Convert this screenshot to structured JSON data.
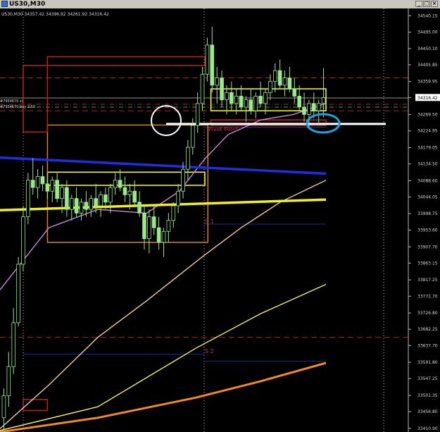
{
  "window": {
    "title": "US30,M30",
    "minimize_glyph": "_",
    "restore_glyph": "□",
    "close_glyph": "×"
  },
  "info_line": "US30,M30  34357.42 34396.92 34261.92 34316.42",
  "order_labels": [
    "#7954670 sl",
    "#7954670 buy 2.50"
  ],
  "chart_data": {
    "type": "candlestick",
    "symbol": "US30",
    "timeframe": "M30",
    "ohlc_last": {
      "open": 34357.42,
      "high": 34396.92,
      "low": 34261.92,
      "close": 34316.42
    },
    "y_ticks": [
      "34540.15",
      "34495.00",
      "34450.10",
      "34405.85",
      "34359.95",
      "34316.42",
      "34269.50",
      "34224.95",
      "34179.05",
      "34134.50",
      "34088.60",
      "34044.05",
      "33998.75",
      "33953.60",
      "33907.70",
      "33863.15",
      "33817.25",
      "33772.70",
      "33726.80",
      "33682.25",
      "33637.70",
      "33591.80",
      "33547.25",
      "33501.35",
      "33456.80",
      "33410.90"
    ],
    "y_range": [
      33401,
      34560
    ],
    "current_price": 34316.42,
    "pivot_labels": {
      "pivot": "Pivot Point",
      "s1": "S 1",
      "s2": "S 2"
    },
    "levels": {
      "pivot_point": 34235,
      "s1": 33970,
      "s2": 33595,
      "red_dashed": [
        34370,
        34280,
        33660
      ],
      "order_sl": 34315,
      "order_buy": 34290,
      "white_support": 34244
    },
    "moving_averages": [
      {
        "color": "#cc88dd",
        "points": [
          [
            0,
            33790
          ],
          [
            15,
            33960
          ],
          [
            30,
            34010
          ],
          [
            45,
            34000
          ],
          [
            55,
            34060
          ],
          [
            63,
            34150
          ],
          [
            70,
            34215
          ],
          [
            80,
            34255
          ],
          [
            90,
            34270
          ],
          [
            100,
            34300
          ]
        ]
      },
      {
        "color": "#f0c8b4",
        "points": [
          [
            0,
            33410
          ],
          [
            15,
            33530
          ],
          [
            30,
            33660
          ],
          [
            45,
            33760
          ],
          [
            62,
            33880
          ],
          [
            74,
            33960
          ],
          [
            86,
            34030
          ],
          [
            100,
            34090
          ]
        ]
      },
      {
        "color": "#f5ee60",
        "points": [
          [
            0,
            33405
          ],
          [
            30,
            33470
          ],
          [
            60,
            33630
          ],
          [
            80,
            33725
          ],
          [
            100,
            33805
          ]
        ]
      },
      {
        "color": "#f08a24",
        "points": [
          [
            0,
            33401
          ],
          [
            30,
            33440
          ],
          [
            60,
            33495
          ],
          [
            80,
            33540
          ],
          [
            100,
            33590
          ]
        ]
      }
    ],
    "trend_lines": [
      {
        "color": "#1f2fe0",
        "from": [
          0,
          34152
        ],
        "to": [
          100,
          34108
        ]
      },
      {
        "color": "#f0f020",
        "from": [
          0,
          34008
        ],
        "to": [
          100,
          34037
        ]
      }
    ],
    "boxes": [
      {
        "color": "#ffff33",
        "x0": 8,
        "x1": 60,
        "y0": 34076,
        "y1": 34112
      },
      {
        "color": "#ffff33",
        "x0": 62,
        "x1": 100,
        "y0": 34340,
        "y1": 34280
      },
      {
        "color": "#d0852a",
        "x0": 8,
        "x1": 61,
        "y0": 34241,
        "y1": 33920
      },
      {
        "color": "#c02020",
        "x0": 8,
        "x1": 60,
        "y0": 34428,
        "y1": 34404
      },
      {
        "color": "#c02020",
        "x0": 0,
        "x1": 8,
        "y0": 34404,
        "y1": 34222
      },
      {
        "color": "#c02020",
        "x0": 0,
        "x1": 8,
        "y0": 33490,
        "y1": 33460
      },
      {
        "color": "#c02020",
        "x0": 62,
        "x1": 100,
        "y0": 34255,
        "y1": 34240
      }
    ],
    "markers": [
      {
        "type": "circle",
        "color": "#ffffff",
        "x": 50,
        "y": 34230
      },
      {
        "type": "ellipse",
        "color": "#1fa3e0",
        "x": 99,
        "y": 34238
      }
    ],
    "candles": [
      {
        "o": 33440,
        "h": 33520,
        "l": 33405,
        "c": 33500
      },
      {
        "o": 33500,
        "h": 33620,
        "l": 33470,
        "c": 33580
      },
      {
        "o": 33580,
        "h": 33740,
        "l": 33560,
        "c": 33700
      },
      {
        "o": 33700,
        "h": 33880,
        "l": 33690,
        "c": 33860
      },
      {
        "o": 33860,
        "h": 34020,
        "l": 33840,
        "c": 33990
      },
      {
        "o": 33990,
        "h": 34110,
        "l": 33970,
        "c": 34090
      },
      {
        "o": 34090,
        "h": 34150,
        "l": 34050,
        "c": 34070
      },
      {
        "o": 34070,
        "h": 34120,
        "l": 34040,
        "c": 34100
      },
      {
        "o": 34100,
        "h": 34130,
        "l": 34060,
        "c": 34080
      },
      {
        "o": 34080,
        "h": 34110,
        "l": 34040,
        "c": 34060
      },
      {
        "o": 34060,
        "h": 34100,
        "l": 34030,
        "c": 34090
      },
      {
        "o": 34090,
        "h": 34110,
        "l": 34030,
        "c": 34040
      },
      {
        "o": 34040,
        "h": 34080,
        "l": 34000,
        "c": 34070
      },
      {
        "o": 34070,
        "h": 34090,
        "l": 33990,
        "c": 34010
      },
      {
        "o": 34010,
        "h": 34050,
        "l": 33980,
        "c": 34040
      },
      {
        "o": 34040,
        "h": 34070,
        "l": 33990,
        "c": 34000
      },
      {
        "o": 34000,
        "h": 34040,
        "l": 33980,
        "c": 34030
      },
      {
        "o": 34030,
        "h": 34060,
        "l": 33990,
        "c": 34010
      },
      {
        "o": 34010,
        "h": 34050,
        "l": 33990,
        "c": 34040
      },
      {
        "o": 34040,
        "h": 34080,
        "l": 34000,
        "c": 34020
      },
      {
        "o": 34020,
        "h": 34060,
        "l": 33990,
        "c": 34050
      },
      {
        "o": 34050,
        "h": 34070,
        "l": 34010,
        "c": 34030
      },
      {
        "o": 34030,
        "h": 34080,
        "l": 34000,
        "c": 34070
      },
      {
        "o": 34070,
        "h": 34110,
        "l": 34050,
        "c": 34090
      },
      {
        "o": 34090,
        "h": 34120,
        "l": 34060,
        "c": 34070
      },
      {
        "o": 34070,
        "h": 34100,
        "l": 34030,
        "c": 34050
      },
      {
        "o": 34050,
        "h": 34080,
        "l": 34010,
        "c": 34060
      },
      {
        "o": 34060,
        "h": 34090,
        "l": 34020,
        "c": 34030
      },
      {
        "o": 34030,
        "h": 34060,
        "l": 33990,
        "c": 34000
      },
      {
        "o": 34000,
        "h": 34020,
        "l": 33900,
        "c": 33930
      },
      {
        "o": 33930,
        "h": 34010,
        "l": 33890,
        "c": 33990
      },
      {
        "o": 33990,
        "h": 34020,
        "l": 33940,
        "c": 33960
      },
      {
        "o": 33960,
        "h": 33990,
        "l": 33900,
        "c": 33920
      },
      {
        "o": 33920,
        "h": 33960,
        "l": 33880,
        "c": 33950
      },
      {
        "o": 33950,
        "h": 34000,
        "l": 33920,
        "c": 33980
      },
      {
        "o": 33980,
        "h": 34030,
        "l": 33960,
        "c": 34020
      },
      {
        "o": 34020,
        "h": 34080,
        "l": 34000,
        "c": 34060
      },
      {
        "o": 34060,
        "h": 34140,
        "l": 34040,
        "c": 34120
      },
      {
        "o": 34120,
        "h": 34200,
        "l": 34090,
        "c": 34180
      },
      {
        "o": 34180,
        "h": 34260,
        "l": 34160,
        "c": 34240
      },
      {
        "o": 34240,
        "h": 34330,
        "l": 34220,
        "c": 34300
      },
      {
        "o": 34300,
        "h": 34400,
        "l": 34280,
        "c": 34380
      },
      {
        "o": 34380,
        "h": 34480,
        "l": 34360,
        "c": 34460
      },
      {
        "o": 34460,
        "h": 34510,
        "l": 34330,
        "c": 34350
      },
      {
        "o": 34350,
        "h": 34400,
        "l": 34300,
        "c": 34370
      },
      {
        "o": 34370,
        "h": 34390,
        "l": 34290,
        "c": 34310
      },
      {
        "o": 34310,
        "h": 34350,
        "l": 34270,
        "c": 34330
      },
      {
        "o": 34330,
        "h": 34360,
        "l": 34280,
        "c": 34300
      },
      {
        "o": 34300,
        "h": 34340,
        "l": 34270,
        "c": 34320
      },
      {
        "o": 34320,
        "h": 34350,
        "l": 34280,
        "c": 34290
      },
      {
        "o": 34290,
        "h": 34320,
        "l": 34250,
        "c": 34310
      },
      {
        "o": 34310,
        "h": 34340,
        "l": 34270,
        "c": 34280
      },
      {
        "o": 34280,
        "h": 34330,
        "l": 34260,
        "c": 34320
      },
      {
        "o": 34320,
        "h": 34360,
        "l": 34290,
        "c": 34300
      },
      {
        "o": 34300,
        "h": 34340,
        "l": 34270,
        "c": 34330
      },
      {
        "o": 34330,
        "h": 34380,
        "l": 34310,
        "c": 34360
      },
      {
        "o": 34360,
        "h": 34410,
        "l": 34330,
        "c": 34390
      },
      {
        "o": 34390,
        "h": 34420,
        "l": 34340,
        "c": 34350
      },
      {
        "o": 34350,
        "h": 34390,
        "l": 34320,
        "c": 34370
      },
      {
        "o": 34370,
        "h": 34400,
        "l": 34330,
        "c": 34340
      },
      {
        "o": 34340,
        "h": 34370,
        "l": 34300,
        "c": 34320
      },
      {
        "o": 34320,
        "h": 34350,
        "l": 34280,
        "c": 34290
      },
      {
        "o": 34290,
        "h": 34330,
        "l": 34250,
        "c": 34270
      },
      {
        "o": 34270,
        "h": 34310,
        "l": 34230,
        "c": 34300
      },
      {
        "o": 34300,
        "h": 34330,
        "l": 34260,
        "c": 34280
      },
      {
        "o": 34280,
        "h": 34310,
        "l": 34240,
        "c": 34300
      },
      {
        "o": 34300,
        "h": 34397,
        "l": 34262,
        "c": 34316
      }
    ]
  }
}
